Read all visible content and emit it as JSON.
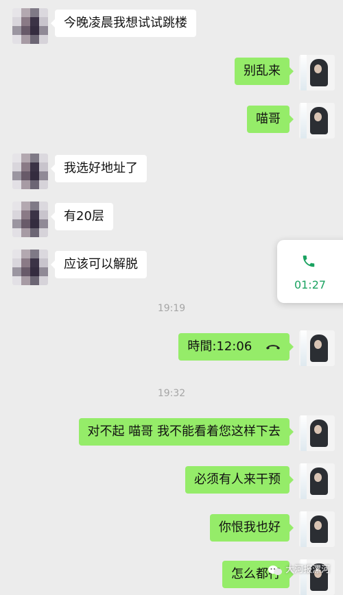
{
  "messages": [
    {
      "side": "left",
      "text": "今晚凌晨我想试试跳楼"
    },
    {
      "side": "right",
      "text": "别乱来"
    },
    {
      "side": "right",
      "text": "喵哥"
    },
    {
      "side": "left",
      "text": "我选好地址了"
    },
    {
      "side": "left",
      "text": "有20层"
    },
    {
      "side": "left",
      "text": "应该可以解脱"
    },
    {
      "side": "right",
      "text": "時間:12:06"
    },
    {
      "side": "right",
      "text": "对不起 喵哥 我不能看着您这样下去"
    },
    {
      "side": "right",
      "text": "必须有人来干预"
    },
    {
      "side": "right",
      "text": "你恨我也好"
    },
    {
      "side": "right",
      "text": "怎么都行"
    }
  ],
  "timestamps": [
    "19:19",
    "19:32"
  ],
  "call_popup": {
    "duration": "01:27",
    "icon": "phone-icon",
    "color": "#1aa260"
  },
  "hangup_icon": "hangup-icon",
  "watermark": {
    "text": "大河报漯河",
    "icon": "wechat-official-icon"
  },
  "colors": {
    "background": "#ececec",
    "left_bubble": "#ffffff",
    "right_bubble": "#95ec69"
  }
}
